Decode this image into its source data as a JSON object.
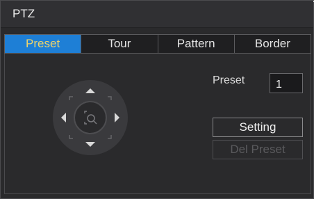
{
  "window": {
    "title": "PTZ"
  },
  "tabs": [
    {
      "label": "Preset",
      "active": true
    },
    {
      "label": "Tour",
      "active": false
    },
    {
      "label": "Pattern",
      "active": false
    },
    {
      "label": "Border",
      "active": false
    }
  ],
  "preset": {
    "label": "Preset",
    "value": "1"
  },
  "buttons": {
    "setting": "Setting",
    "del_preset": "Del Preset"
  },
  "colors": {
    "accent": "#1e7fd6",
    "active_tab_text": "#f0d468"
  }
}
